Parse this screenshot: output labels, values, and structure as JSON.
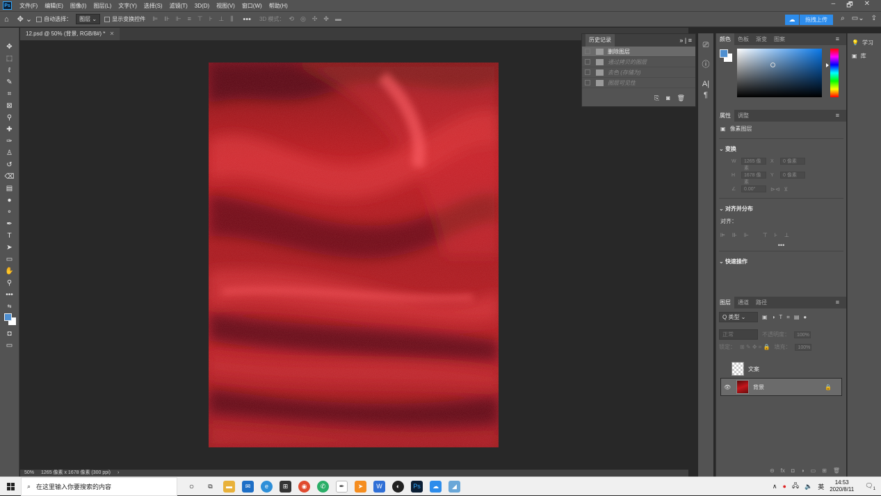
{
  "app": {
    "logo": "Ps"
  },
  "menu": [
    "文件(F)",
    "编辑(E)",
    "图像(I)",
    "图层(L)",
    "文字(Y)",
    "选择(S)",
    "滤镜(T)",
    "3D(D)",
    "视图(V)",
    "窗口(W)",
    "帮助(H)"
  ],
  "window_controls": {
    "minimize": "–",
    "restore": "🗗",
    "close": "✕"
  },
  "options": {
    "auto_select_label": "自动选择：",
    "auto_select_value": "图层",
    "show_transform_label": "显示变换控件",
    "mode_3d_label": "3D 模式：",
    "upload_label": "拖拽上传"
  },
  "document": {
    "tab_title": "12.psd @ 50% (背景, RGB/8#) *"
  },
  "status": {
    "zoom": "50%",
    "info": "1265 像素 x 1678 像素 (300 ppi)"
  },
  "history": {
    "tab": "历史记录",
    "items": [
      {
        "label": "删除图层",
        "state": "current"
      },
      {
        "label": "通过拷贝的图层",
        "state": "dim"
      },
      {
        "label": "去色 (存储为)",
        "state": "dim"
      },
      {
        "label": "图层可见性",
        "state": "dim"
      }
    ]
  },
  "color_panel": {
    "tabs": [
      "颜色",
      "色板",
      "渐变",
      "图案"
    ],
    "foreground": "#4f8fd0",
    "background": "#ffffff"
  },
  "properties": {
    "tabs": [
      "属性",
      "调整"
    ],
    "layer_type": "像素图层",
    "transform_section": "变换",
    "w_label": "W",
    "w_value": "1265 像素",
    "h_label": "H",
    "h_value": "1678 像素",
    "x_label": "X",
    "x_value": "0 像素",
    "y_label": "Y",
    "y_value": "0 像素",
    "angle_value": "0.00°",
    "align_section": "对齐并分布",
    "align_label": "对齐：",
    "quick_section": "快速操作"
  },
  "layers": {
    "tabs": [
      "图层",
      "通道",
      "路径"
    ],
    "filter_label": "Q 类型",
    "blend_mode": "正常",
    "opacity_label": "不透明度：",
    "opacity_value": "100%",
    "lock_label": "锁定：",
    "fill_label": "填充：",
    "fill_value": "100%",
    "items": [
      {
        "name": "文案",
        "visible": false,
        "thumb": "checker"
      },
      {
        "name": "背景",
        "visible": true,
        "thumb": "red",
        "locked": true
      }
    ]
  },
  "side_panel": {
    "learn": "学习",
    "library": "库"
  },
  "taskbar": {
    "search_placeholder": "在这里输入你要搜索的内容",
    "ime": "英",
    "time": "14:53",
    "date": "2020/8/11",
    "notifications": "1"
  },
  "colors": {
    "accent": "#2d8ceb",
    "ui_bg": "#535353",
    "canvas_bg": "#282828",
    "cloth": "#b8141a"
  }
}
